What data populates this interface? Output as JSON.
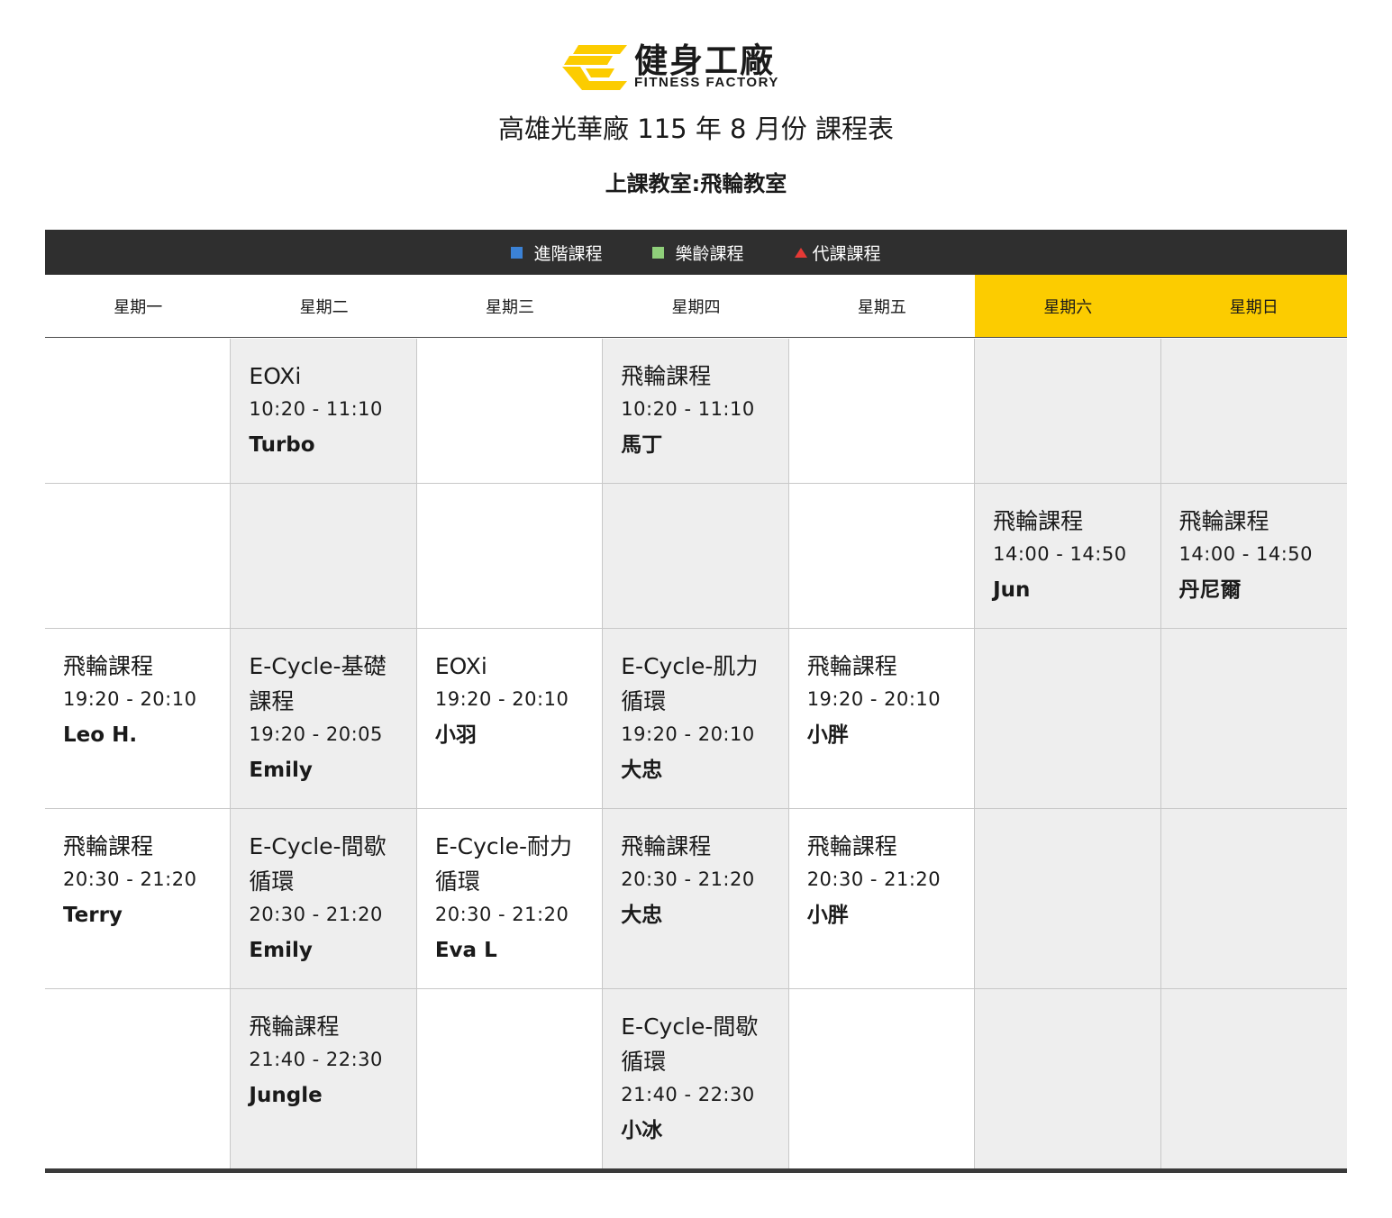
{
  "brand": {
    "name_zh": "健身工廠",
    "name_en": "FITNESS FACTORY",
    "accent": "#fccc00"
  },
  "title": "高雄光華廠 115 年 8 月份 課程表",
  "subtitle": "上課教室:飛輪教室",
  "legend": [
    {
      "label": "進階課程",
      "color": "#3b82d6",
      "shape": "square"
    },
    {
      "label": "樂齡課程",
      "color": "#8fcf7a",
      "shape": "square"
    },
    {
      "label": "代課課程",
      "color": "#e53935",
      "shape": "triangle"
    }
  ],
  "days": [
    "星期一",
    "星期二",
    "星期三",
    "星期四",
    "星期五",
    "星期六",
    "星期日"
  ],
  "rows": [
    [
      null,
      {
        "name": "EOXi",
        "time": "10:20 - 11:10",
        "teacher": "Turbo"
      },
      null,
      {
        "name": "飛輪課程",
        "time": "10:20 - 11:10",
        "teacher": "馬丁"
      },
      null,
      null,
      null
    ],
    [
      null,
      null,
      null,
      null,
      null,
      {
        "name": "飛輪課程",
        "time": "14:00 - 14:50",
        "teacher": "Jun"
      },
      {
        "name": "飛輪課程",
        "time": "14:00 - 14:50",
        "teacher": "丹尼爾"
      }
    ],
    [
      {
        "name": "飛輪課程",
        "time": "19:20 - 20:10",
        "teacher": "Leo H."
      },
      {
        "name": "E-Cycle-基礎課程",
        "time": "19:20 - 20:05",
        "teacher": "Emily"
      },
      {
        "name": "EOXi",
        "time": "19:20 - 20:10",
        "teacher": "小羽"
      },
      {
        "name": "E-Cycle-肌力循環",
        "time": "19:20 - 20:10",
        "teacher": "大忠"
      },
      {
        "name": "飛輪課程",
        "time": "19:20 - 20:10",
        "teacher": "小胖"
      },
      null,
      null
    ],
    [
      {
        "name": "飛輪課程",
        "time": "20:30 - 21:20",
        "teacher": "Terry"
      },
      {
        "name": "E-Cycle-間歇循環",
        "time": "20:30 - 21:20",
        "teacher": "Emily"
      },
      {
        "name": "E-Cycle-耐力循環",
        "time": "20:30 - 21:20",
        "teacher": "Eva L"
      },
      {
        "name": "飛輪課程",
        "time": "20:30 - 21:20",
        "teacher": "大忠"
      },
      {
        "name": "飛輪課程",
        "time": "20:30 - 21:20",
        "teacher": "小胖"
      },
      null,
      null
    ],
    [
      null,
      {
        "name": "飛輪課程",
        "time": "21:40 - 22:30",
        "teacher": "Jungle"
      },
      null,
      {
        "name": "E-Cycle-間歇循環",
        "time": "21:40 - 22:30",
        "teacher": "小冰"
      },
      null,
      null,
      null
    ]
  ]
}
